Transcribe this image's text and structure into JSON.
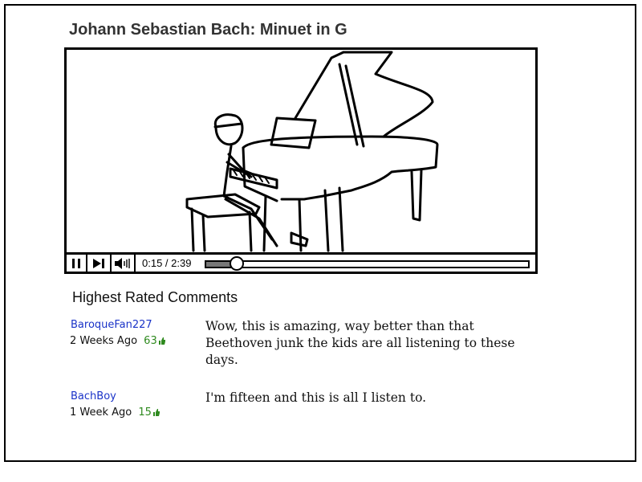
{
  "video": {
    "title": "Johann Sebastian Bach: Minuet in G",
    "time_display": "0:15 / 2:39",
    "progress_fraction": 0.094
  },
  "comments_section": {
    "heading": "Highest Rated Comments",
    "comments": [
      {
        "user": "BaroqueFan227",
        "age": "2 Weeks Ago",
        "votes": "63",
        "text": "Wow, this is amazing, way better than that Beethoven junk the kids are all listening to these days."
      },
      {
        "user": "BachBoy",
        "age": "1 Week Ago",
        "votes": "15",
        "text": "I'm fifteen and this is all I listen to."
      }
    ]
  },
  "icons": {
    "pause": "pause-icon",
    "next": "skip-next-icon",
    "volume": "volume-icon",
    "thumbs_up": "thumbs-up-icon"
  },
  "colors": {
    "username": "#1a33c8",
    "votes": "#2f8a1f"
  }
}
